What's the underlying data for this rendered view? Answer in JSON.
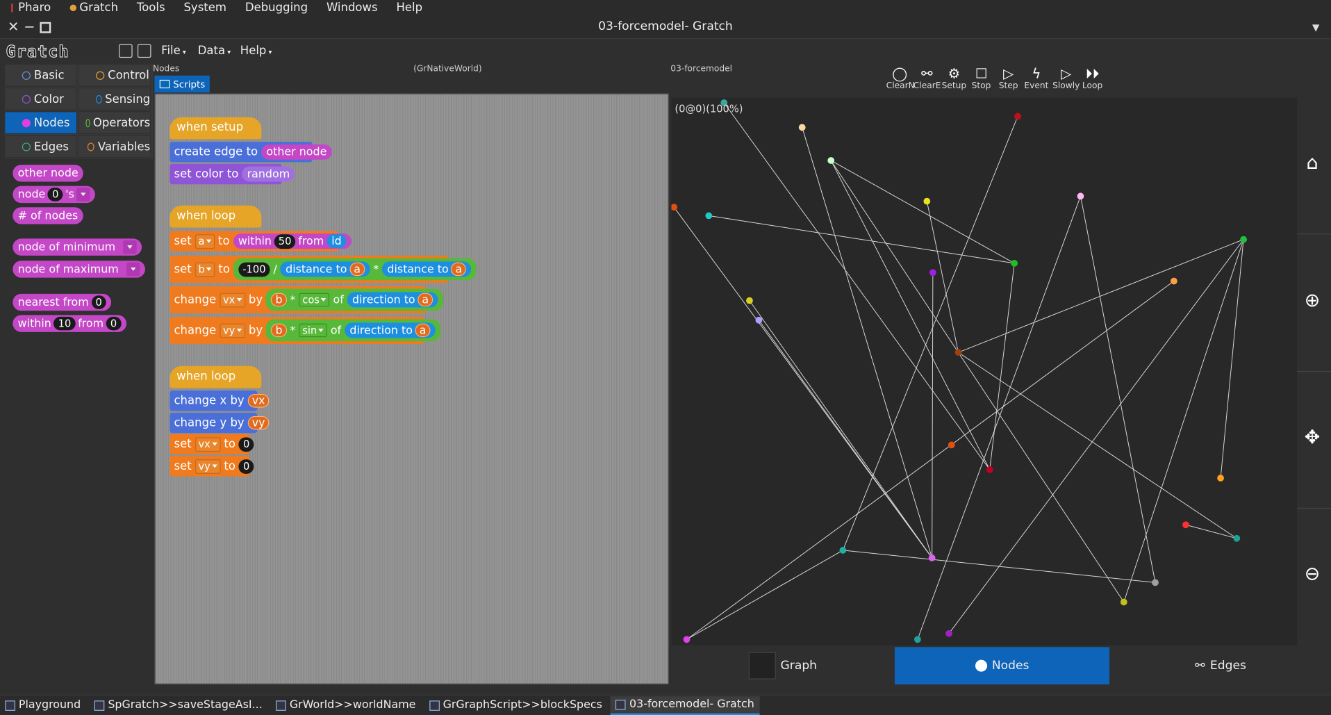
{
  "menubar": {
    "items": [
      "Pharo",
      "Gratch",
      "Tools",
      "System",
      "Debugging",
      "Windows",
      "Help"
    ]
  },
  "window": {
    "title": "03-forcemodel- Gratch"
  },
  "app": {
    "logo": "Gratch",
    "menus": [
      "File",
      "Data",
      "Help"
    ]
  },
  "categories": [
    {
      "label": "Basic",
      "color": "#6b8fd8"
    },
    {
      "label": "Control",
      "color": "#e6a526"
    },
    {
      "label": "Color",
      "color": "#8f55d6"
    },
    {
      "label": "Sensing",
      "color": "#1c8fe0"
    },
    {
      "label": "Nodes",
      "color": "#c447c7",
      "selected": true
    },
    {
      "label": "Operators",
      "color": "#58b83a"
    },
    {
      "label": "Edges",
      "color": "#3ba88c"
    },
    {
      "label": "Variables",
      "color": "#e9852c"
    }
  ],
  "palette": {
    "other_node": "other node",
    "node_of_a": "node",
    "node_of_num": "0",
    "node_of_b": "'s",
    "num_nodes": "# of nodes",
    "node_min": "node of minimum",
    "node_max": "node of maximum",
    "nearest": "nearest from",
    "nearest_num": "0",
    "within_a": "within",
    "within_num": "10",
    "within_b": "from",
    "within_num2": "0"
  },
  "panes": {
    "nodes_label": "Nodes",
    "world_label": "(GrNativeWorld)",
    "project_label": "03-forcemodel",
    "scripts_tab": "Scripts"
  },
  "scripts": {
    "s1_hat": "when setup",
    "s1_b1": "create edge to",
    "s1_b1_arg": "other node",
    "s1_b2": "set color to",
    "s1_b2_arg": "random",
    "s2_hat": "when loop",
    "set": "set",
    "to": "to",
    "var_a": "a",
    "var_b": "b",
    "within": "within",
    "fifty": "50",
    "from": "from",
    "id": "id",
    "neg100": "-100",
    "slash": "/",
    "distance_to": "distance to",
    "times": "*",
    "change": "change",
    "by": "by",
    "var_vx": "vx",
    "var_vy": "vy",
    "cos": "cos",
    "sin": "sin",
    "of": "of",
    "direction_to": "direction to",
    "s3_hat": "when loop",
    "change_x": "change x by",
    "change_y": "change y by",
    "zero": "0"
  },
  "tools": [
    "ClearN",
    "ClearE",
    "Setup",
    "Stop",
    "Step",
    "Event",
    "Slowly",
    "Loop"
  ],
  "stage": {
    "info": "(0@0)(100%)"
  },
  "bottom_tabs": [
    "Graph",
    "Nodes",
    "Edges"
  ],
  "taskbar": [
    "Playground",
    "SpGratch>>saveStageAsI...",
    "GrWorld>>worldName",
    "GrGraphScript>>blockSpecs",
    "03-forcemodel- Gratch"
  ],
  "graph": {
    "nodes": [
      {
        "id": 0,
        "color": "#3ba8a0"
      },
      {
        "id": 1,
        "color": "#ffd8a0"
      },
      {
        "id": 2,
        "color": "#c8ffc8"
      },
      {
        "id": 3,
        "color": "#c0101a"
      },
      {
        "id": 4,
        "color": "#e8e020"
      },
      {
        "id": 5,
        "color": "#ffb8f0"
      },
      {
        "id": 6,
        "color": "#e05010"
      },
      {
        "id": 7,
        "color": "#20c8c8"
      },
      {
        "id": 8,
        "color": "#20c040"
      },
      {
        "id": 9,
        "color": "#20c020"
      },
      {
        "id": 10,
        "color": "#a020e0"
      },
      {
        "id": 11,
        "color": "#ffa040"
      },
      {
        "id": 12,
        "color": "#d8d020"
      },
      {
        "id": 13,
        "color": "#a8a0ff"
      },
      {
        "id": 14,
        "color": "#a04010"
      },
      {
        "id": 15,
        "color": "#e05010"
      },
      {
        "id": 16,
        "color": "#c00020"
      },
      {
        "id": 17,
        "color": "#ffa020"
      },
      {
        "id": 18,
        "color": "#ff3030"
      },
      {
        "id": 19,
        "color": "#20a090"
      },
      {
        "id": 20,
        "color": "#20b0a0"
      },
      {
        "id": 21,
        "color": "#e060f0"
      },
      {
        "id": 22,
        "color": "#a0a0a0"
      },
      {
        "id": 23,
        "color": "#c0c020"
      },
      {
        "id": 24,
        "color": "#e040f0"
      },
      {
        "id": 25,
        "color": "#20a0a0"
      },
      {
        "id": 26,
        "color": "#a020c0"
      }
    ],
    "edges": [
      [
        0,
        16
      ],
      [
        1,
        21
      ],
      [
        2,
        23
      ],
      [
        2,
        9
      ],
      [
        3,
        20
      ],
      [
        4,
        14
      ],
      [
        5,
        25
      ],
      [
        5,
        22
      ],
      [
        6,
        21
      ],
      [
        7,
        9
      ],
      [
        8,
        14
      ],
      [
        8,
        26
      ],
      [
        8,
        23
      ],
      [
        9,
        16
      ],
      [
        10,
        21
      ],
      [
        11,
        24
      ],
      [
        12,
        21
      ],
      [
        13,
        21
      ],
      [
        14,
        19
      ],
      [
        17,
        8
      ],
      [
        18,
        19
      ],
      [
        20,
        22
      ],
      [
        16,
        2
      ],
      [
        20,
        24
      ]
    ]
  }
}
